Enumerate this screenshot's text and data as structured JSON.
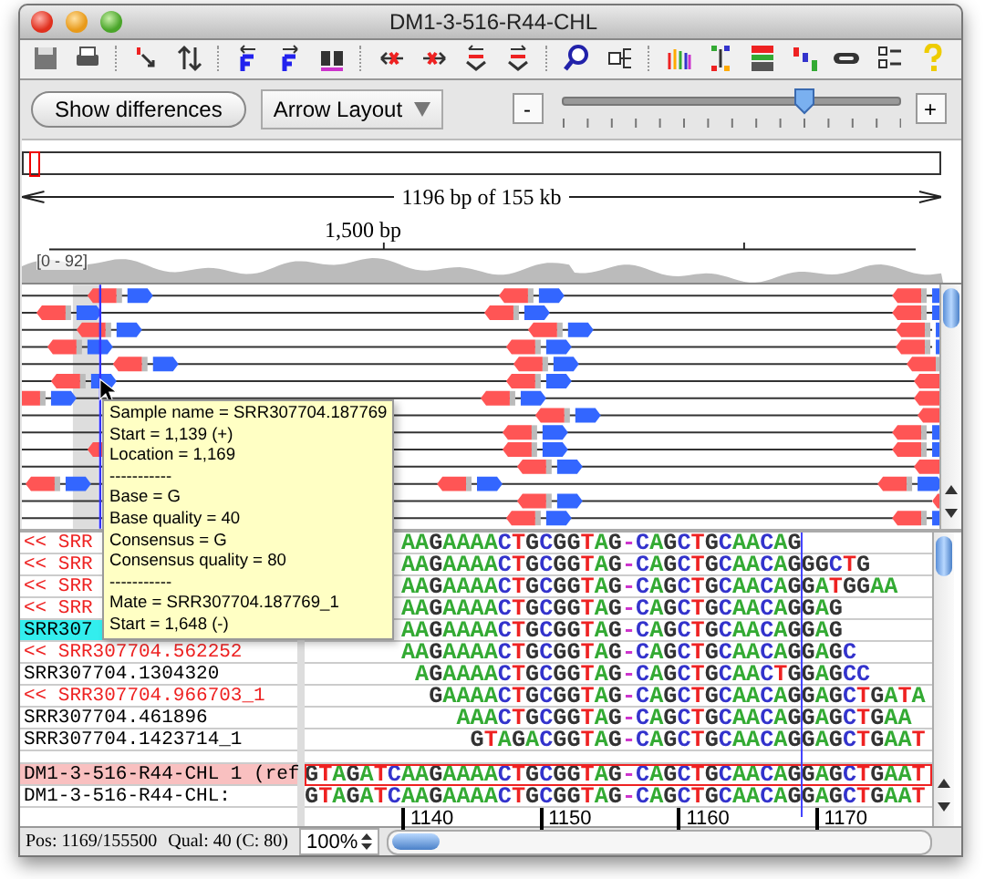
{
  "window": {
    "title": "DM1-3-516-R44-CHL"
  },
  "controls": {
    "show_differences": "Show differences",
    "layout": "Arrow Layout",
    "zoom_out": "-",
    "zoom_in": "+",
    "zoom_slider": {
      "level": 0.72
    }
  },
  "overview": {
    "range_label": "1196 bp of 155 kb",
    "ruler_label": "1,500 bp",
    "coverage_range": "[0 - 92]"
  },
  "tooltip": {
    "lines": [
      "Sample name = SRR307704.187769",
      "Start = 1,139 (+)",
      "Location = 1,169",
      "-----------",
      "Base = G",
      "Base quality = 40",
      "Consensus = G",
      "Consensus quality = 80",
      "-----------",
      "Mate = SRR307704.187769_1",
      "Start = 1,648 (-)"
    ]
  },
  "reads": [
    {
      "name": "<< SRR",
      "kind": "reverse",
      "selected": false,
      "sequence": "       AAGAAAACTGCGGTAG-CAGCTGCAACAG"
    },
    {
      "name": "<< SRR",
      "kind": "reverse",
      "selected": false,
      "sequence": "       AAGAAAACTGCGGTAG-CAGCTGCAACAGGGCTG"
    },
    {
      "name": "<< SRR",
      "kind": "reverse",
      "selected": false,
      "sequence": "       AAGAAAACTGCGGTAG-CAGCTGCAACAGGATGGAA"
    },
    {
      "name": "<< SRR",
      "kind": "reverse",
      "selected": false,
      "sequence": "       AAGAAAACTGCGGTAG-CAGCTGCAACAGGAG"
    },
    {
      "name": "SRR307",
      "kind": "forward",
      "selected": true,
      "sequence": "       AAGAAAACTGCGGTAG-CAGCTGCAACAGGAG"
    },
    {
      "name": "<< SRR307704.562252",
      "kind": "reverse",
      "selected": false,
      "sequence": "       AAGAAAACTGCGGTAG-CAGCTGCAACAGGAGC"
    },
    {
      "name": "SRR307704.1304320",
      "kind": "forward",
      "selected": false,
      "sequence": "        AGAAAACTGCGGTAG-CAGCTGCAACTGGAGCC"
    },
    {
      "name": "<< SRR307704.966703_1",
      "kind": "reverse",
      "selected": false,
      "sequence": "         GAAAACTGCGGTAG-CAGCTGCAACAGGAGCTGATA"
    },
    {
      "name": "SRR307704.461896",
      "kind": "forward",
      "selected": false,
      "sequence": "           AAACTGCGGTAG-CAGCTGCAACAGGAGCTGAA"
    },
    {
      "name": "SRR307704.1423714_1",
      "kind": "forward",
      "selected": false,
      "sequence": "            GTAGACGGTAG-CAGCTGCAACAGGAGCTGAAT"
    },
    {
      "name": "DM1-3-516-R44-CHL 1 (ref",
      "kind": "reference",
      "selected": false,
      "sequence": "GTAGATCAAGAAAACTGCGGTAG-CAGCTGCAACAGGAGCTGAAT"
    },
    {
      "name": "DM1-3-516-R44-CHL:",
      "kind": "consensus",
      "selected": false,
      "sequence": "GTAGATCAAGAAAACTGCGGTAG-CAGCTGCAACAGGAGCTGAAT"
    }
  ],
  "sequence_ruler": [
    "1140",
    "1150",
    "1160",
    "1170"
  ],
  "status_bar": {
    "position": "Pos: 1169/155500",
    "quality": "Qual: 40 (C: 80)",
    "zoom": "100%"
  }
}
